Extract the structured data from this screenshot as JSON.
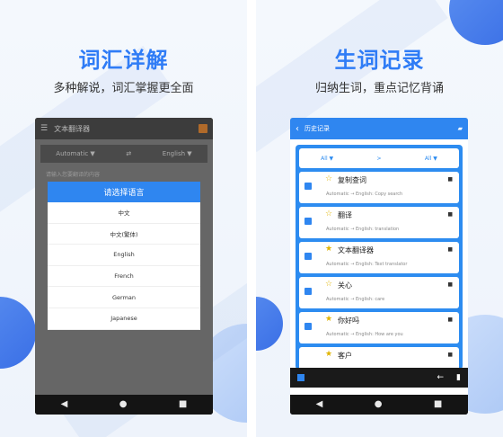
{
  "left": {
    "headline": "词汇详解",
    "subline": "多种解说，词汇掌握更全面",
    "appbar_title": "文本翻译器",
    "source_lang": "Automatic ▼",
    "swap_icon": "⇄",
    "target_lang": "English ▼",
    "input_hint": "请输入您要翻译的内容",
    "dialog": {
      "title": "请选择语言",
      "options": [
        "中文",
        "中文(繁体)",
        "English",
        "French",
        "German",
        "Japanese"
      ]
    }
  },
  "right": {
    "headline": "生词记录",
    "subline": "归纳生词，重点记忆背诵",
    "appbar_title": "历史记录",
    "filter": {
      "left": "All ▼",
      "middle": ">",
      "right": "All ▼"
    },
    "items": [
      {
        "word": "复制查词",
        "detail": "Automatic → English:  Copy search",
        "starred": false
      },
      {
        "word": "翻译",
        "detail": "Automatic → English:  translation",
        "starred": false
      },
      {
        "word": "文本翻译器",
        "detail": "Automatic → English:  Text translator",
        "starred": true
      },
      {
        "word": "关心",
        "detail": "Automatic → English:  care",
        "starred": false
      },
      {
        "word": "你好吗",
        "detail": "Automatic → English:  How are you",
        "starred": true
      },
      {
        "word": "客户",
        "detail": "",
        "starred": true
      }
    ]
  },
  "nav": {
    "back": "◀",
    "home": "●",
    "recent": "■"
  },
  "colors": {
    "accent": "#2f86f0",
    "headline": "#2f7cf6",
    "star": "#e0b400"
  }
}
